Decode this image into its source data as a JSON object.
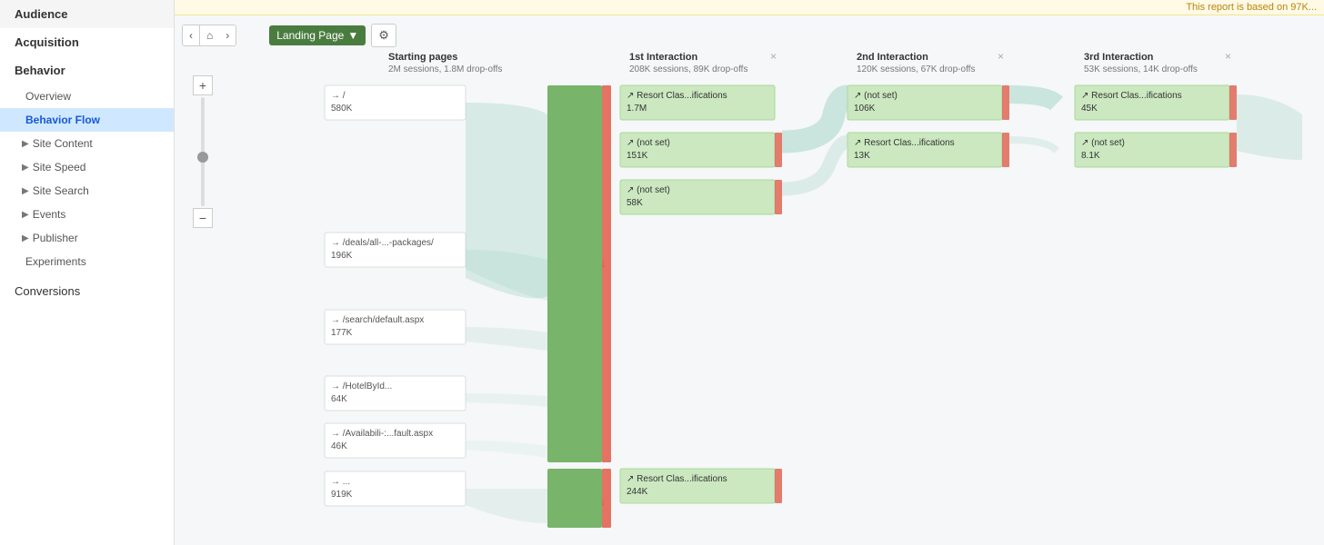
{
  "topbar": {
    "notice": "This report is based on 97K..."
  },
  "sidebar": {
    "sections": [
      {
        "id": "audience",
        "label": "Audience",
        "level": "top",
        "active": false
      },
      {
        "id": "acquisition",
        "label": "Acquisition",
        "level": "top",
        "active": false
      },
      {
        "id": "behavior",
        "label": "Behavior",
        "level": "top",
        "active": true
      },
      {
        "id": "overview",
        "label": "Overview",
        "level": "sub",
        "active": false
      },
      {
        "id": "behavior-flow",
        "label": "Behavior Flow",
        "level": "sub",
        "active": true
      },
      {
        "id": "site-content",
        "label": "Site Content",
        "level": "group",
        "active": false
      },
      {
        "id": "site-speed",
        "label": "Site Speed",
        "level": "group",
        "active": false
      },
      {
        "id": "site-search",
        "label": "Site Search",
        "level": "group",
        "active": false
      },
      {
        "id": "events",
        "label": "Events",
        "level": "group",
        "active": false
      },
      {
        "id": "publisher",
        "label": "Publisher",
        "level": "group",
        "active": false
      },
      {
        "id": "experiments",
        "label": "Experiments",
        "level": "sub2",
        "active": false
      },
      {
        "id": "conversions",
        "label": "Conversions",
        "level": "top2",
        "active": false
      }
    ]
  },
  "controls": {
    "dropdown_label": "Landing Page",
    "dropdown_arrow": "▼",
    "gear_icon": "⚙",
    "nav_left": "‹",
    "nav_home": "⌂",
    "nav_right": "›",
    "zoom_plus": "+",
    "zoom_minus": "−"
  },
  "columns": [
    {
      "id": "starting",
      "title": "Starting pages",
      "subtitle": "2M sessions, 1.8M drop-offs",
      "has_close": false,
      "nodes": [
        {
          "id": "root",
          "label": "/",
          "count": "580K"
        },
        {
          "id": "deals",
          "label": "/deals/all-...-packages/",
          "count": "196K"
        },
        {
          "id": "search",
          "label": "/search/default.aspx",
          "count": "177K"
        },
        {
          "id": "hotel",
          "label": "/HotelById...",
          "count": "64K"
        },
        {
          "id": "avail",
          "label": "/Availabili-:...fault.aspx",
          "count": "46K"
        },
        {
          "id": "other",
          "label": "...",
          "count": "919K"
        }
      ]
    },
    {
      "id": "interaction1",
      "title": "1st Interaction",
      "subtitle": "208K sessions, 89K drop-offs",
      "has_close": true,
      "nodes": [
        {
          "id": "i1_1",
          "label": "Resort Clas...ifications",
          "count": "1.7M",
          "large": true
        },
        {
          "id": "i1_2",
          "label": "(not set)",
          "count": "151K"
        },
        {
          "id": "i1_3",
          "label": "(not set)",
          "count": "58K"
        },
        {
          "id": "i1_4",
          "label": "Resort Clas...ifications",
          "count": "244K"
        }
      ]
    },
    {
      "id": "interaction2",
      "title": "2nd Interaction",
      "subtitle": "120K sessions, 67K drop-offs",
      "has_close": true,
      "nodes": [
        {
          "id": "i2_1",
          "label": "(not set)",
          "count": "106K"
        },
        {
          "id": "i2_2",
          "label": "Resort Clas...ifications",
          "count": "13K"
        }
      ]
    },
    {
      "id": "interaction3",
      "title": "3rd Interaction",
      "subtitle": "53K sessions, 14K drop-offs",
      "has_close": true,
      "nodes": [
        {
          "id": "i3_1",
          "label": "Resort Clas...ifications",
          "count": "45K"
        },
        {
          "id": "i3_2",
          "label": "(not set)",
          "count": "8.1K"
        }
      ]
    }
  ]
}
